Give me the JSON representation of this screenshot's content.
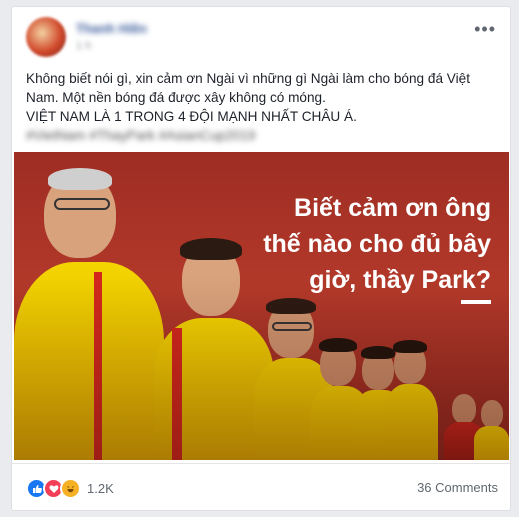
{
  "post": {
    "author": "Thanh Hiền",
    "timestamp": "1 h",
    "more_label": "•••",
    "text": {
      "line1": "Không biết nói gì, xin cảm ơn Ngài vì những gì Ngài làm cho bóng đá Việt Nam. Một nền bóng đá được xây không có móng.",
      "line2": "VIỆT NAM LÀ 1 TRONG 4 ĐỘI MẠNH NHẤT CHÂU Á.",
      "line3": "#VietNam #ThayPark #AsianCup2019"
    },
    "image": {
      "headline": [
        "Biết cảm ơn ông",
        "thế nào cho đủ bây",
        "giờ, thầy Park?"
      ]
    },
    "reactions": {
      "icons": [
        "like-icon",
        "love-icon",
        "haha-icon"
      ],
      "count": "1.2K"
    },
    "comments": "36 Comments"
  },
  "colors": {
    "link_blue": "#365899",
    "like_blue": "#1877f2",
    "love_red": "#f33e58",
    "haha_yellow": "#f7b125",
    "image_red": "#b3392a",
    "jersey_yellow": "#f3d400"
  }
}
